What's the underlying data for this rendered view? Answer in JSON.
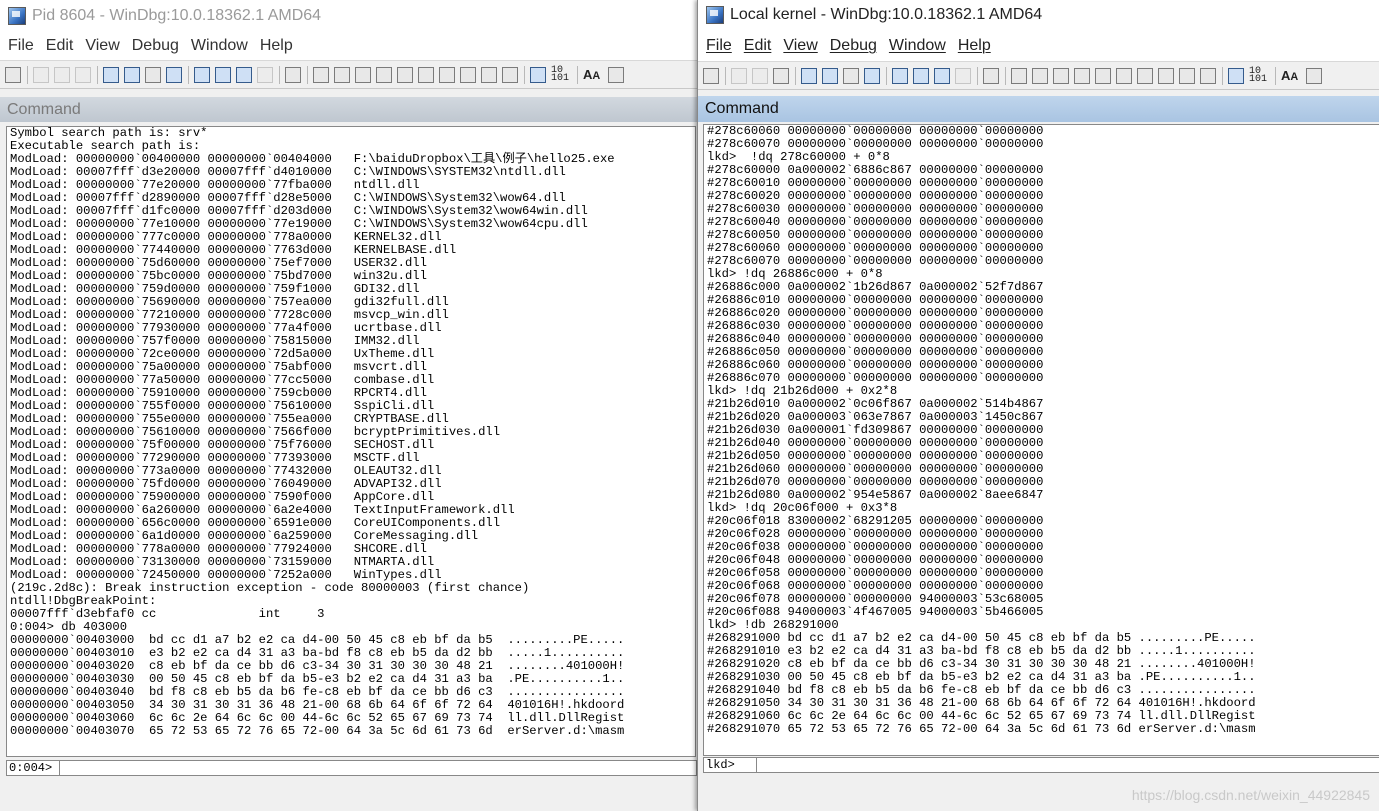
{
  "left_window": {
    "title": "Pid 8604 - WinDbg:10.0.18362.1 AMD64",
    "menu": [
      "File",
      "Edit",
      "View",
      "Debug",
      "Window",
      "Help"
    ],
    "command_header": "Command",
    "prompt": "0:004>",
    "input_value": "",
    "lines": [
      "Symbol search path is: srv*",
      "Executable search path is:",
      "ModLoad: 00000000`00400000 00000000`00404000   F:\\baiduDropbox\\工具\\例子\\hello25.exe",
      "ModLoad: 00007fff`d3e20000 00007fff`d4010000   C:\\WINDOWS\\SYSTEM32\\ntdll.dll",
      "ModLoad: 00000000`77e20000 00000000`77fba000   ntdll.dll",
      "ModLoad: 00007fff`d2890000 00007fff`d28e5000   C:\\WINDOWS\\System32\\wow64.dll",
      "ModLoad: 00007fff`d1fc0000 00007fff`d203d000   C:\\WINDOWS\\System32\\wow64win.dll",
      "ModLoad: 00000000`77e10000 00000000`77e19000   C:\\WINDOWS\\System32\\wow64cpu.dll",
      "ModLoad: 00000000`777c0000 00000000`778a0000   KERNEL32.dll",
      "ModLoad: 00000000`77440000 00000000`7763d000   KERNELBASE.dll",
      "ModLoad: 00000000`75d60000 00000000`75ef7000   USER32.dll",
      "ModLoad: 00000000`75bc0000 00000000`75bd7000   win32u.dll",
      "ModLoad: 00000000`759d0000 00000000`759f1000   GDI32.dll",
      "ModLoad: 00000000`75690000 00000000`757ea000   gdi32full.dll",
      "ModLoad: 00000000`77210000 00000000`7728c000   msvcp_win.dll",
      "ModLoad: 00000000`77930000 00000000`77a4f000   ucrtbase.dll",
      "ModLoad: 00000000`757f0000 00000000`75815000   IMM32.dll",
      "ModLoad: 00000000`72ce0000 00000000`72d5a000   UxTheme.dll",
      "ModLoad: 00000000`75a00000 00000000`75abf000   msvcrt.dll",
      "ModLoad: 00000000`77a50000 00000000`77cc5000   combase.dll",
      "ModLoad: 00000000`75910000 00000000`759cb000   RPCRT4.dll",
      "ModLoad: 00000000`755f0000 00000000`75610000   SspiCli.dll",
      "ModLoad: 00000000`755e0000 00000000`755ea000   CRYPTBASE.dll",
      "ModLoad: 00000000`75610000 00000000`7566f000   bcryptPrimitives.dll",
      "ModLoad: 00000000`75f00000 00000000`75f76000   SECHOST.dll",
      "ModLoad: 00000000`77290000 00000000`77393000   MSCTF.dll",
      "ModLoad: 00000000`773a0000 00000000`77432000   OLEAUT32.dll",
      "ModLoad: 00000000`75fd0000 00000000`76049000   ADVAPI32.dll",
      "ModLoad: 00000000`75900000 00000000`7590f000   AppCore.dll",
      "ModLoad: 00000000`6a260000 00000000`6a2e4000   TextInputFramework.dll",
      "ModLoad: 00000000`656c0000 00000000`6591e000   CoreUIComponents.dll",
      "ModLoad: 00000000`6a1d0000 00000000`6a259000   CoreMessaging.dll",
      "ModLoad: 00000000`778a0000 00000000`77924000   SHCORE.dll",
      "ModLoad: 00000000`73130000 00000000`73159000   NTMARTA.dll",
      "ModLoad: 00000000`72450000 00000000`7252a000   WinTypes.dll",
      "(219c.2d8c): Break instruction exception - code 80000003 (first chance)",
      "ntdll!DbgBreakPoint:",
      "00007fff`d3ebfaf0 cc              int     3",
      "0:004> db 403000",
      "00000000`00403000  bd cc d1 a7 b2 e2 ca d4-00 50 45 c8 eb bf da b5  .........PE.....",
      "00000000`00403010  e3 b2 e2 ca d4 31 a3 ba-bd f8 c8 eb b5 da d2 bb  .....1..........",
      "00000000`00403020  c8 eb bf da ce bb d6 c3-34 30 31 30 30 30 48 21  ........401000H!",
      "00000000`00403030  00 50 45 c8 eb bf da b5-e3 b2 e2 ca d4 31 a3 ba  .PE..........1..",
      "00000000`00403040  bd f8 c8 eb b5 da b6 fe-c8 eb bf da ce bb d6 c3  ................",
      "00000000`00403050  34 30 31 30 31 36 48 21-00 68 6b 64 6f 6f 72 64  401016H!.hkdoord",
      "00000000`00403060  6c 6c 2e 64 6c 6c 00 44-6c 6c 52 65 67 69 73 74  ll.dll.DllRegist",
      "00000000`00403070  65 72 53 65 72 76 65 72-00 64 3a 5c 6d 61 73 6d  erServer.d:\\masm"
    ]
  },
  "right_window": {
    "title": "Local kernel - WinDbg:10.0.18362.1 AMD64",
    "menu": [
      "File",
      "Edit",
      "View",
      "Debug",
      "Window",
      "Help"
    ],
    "command_header": "Command",
    "prompt": "lkd>",
    "input_value": "",
    "lines": [
      "#278c60060 00000000`00000000 00000000`00000000",
      "#278c60070 00000000`00000000 00000000`00000000",
      "lkd>  !dq 278c60000 + 0*8",
      "#278c60000 0a000002`6886c867 00000000`00000000",
      "#278c60010 00000000`00000000 00000000`00000000",
      "#278c60020 00000000`00000000 00000000`00000000",
      "#278c60030 00000000`00000000 00000000`00000000",
      "#278c60040 00000000`00000000 00000000`00000000",
      "#278c60050 00000000`00000000 00000000`00000000",
      "#278c60060 00000000`00000000 00000000`00000000",
      "#278c60070 00000000`00000000 00000000`00000000",
      "lkd> !dq 26886c000 + 0*8",
      "#26886c000 0a000002`1b26d867 0a000002`52f7d867",
      "#26886c010 00000000`00000000 00000000`00000000",
      "#26886c020 00000000`00000000 00000000`00000000",
      "#26886c030 00000000`00000000 00000000`00000000",
      "#26886c040 00000000`00000000 00000000`00000000",
      "#26886c050 00000000`00000000 00000000`00000000",
      "#26886c060 00000000`00000000 00000000`00000000",
      "#26886c070 00000000`00000000 00000000`00000000",
      "lkd> !dq 21b26d000 + 0x2*8",
      "#21b26d010 0a000002`0c06f867 0a000002`514b4867",
      "#21b26d020 0a000003`063e7867 0a000003`1450c867",
      "#21b26d030 0a000001`fd309867 00000000`00000000",
      "#21b26d040 00000000`00000000 00000000`00000000",
      "#21b26d050 00000000`00000000 00000000`00000000",
      "#21b26d060 00000000`00000000 00000000`00000000",
      "#21b26d070 00000000`00000000 00000000`00000000",
      "#21b26d080 0a000002`954e5867 0a000002`8aee6847",
      "lkd> !dq 20c06f000 + 0x3*8",
      "#20c06f018 83000002`68291205 00000000`00000000",
      "#20c06f028 00000000`00000000 00000000`00000000",
      "#20c06f038 00000000`00000000 00000000`00000000",
      "#20c06f048 00000000`00000000 00000000`00000000",
      "#20c06f058 00000000`00000000 00000000`00000000",
      "#20c06f068 00000000`00000000 00000000`00000000",
      "#20c06f078 00000000`00000000 94000003`53c68005",
      "#20c06f088 94000003`4f467005 94000003`5b466005",
      "lkd> !db 268291000",
      "#268291000 bd cc d1 a7 b2 e2 ca d4-00 50 45 c8 eb bf da b5 .........PE.....",
      "#268291010 e3 b2 e2 ca d4 31 a3 ba-bd f8 c8 eb b5 da d2 bb .....1..........",
      "#268291020 c8 eb bf da ce bb d6 c3-34 30 31 30 30 30 48 21 ........401000H!",
      "#268291030 00 50 45 c8 eb bf da b5-e3 b2 e2 ca d4 31 a3 ba .PE..........1..",
      "#268291040 bd f8 c8 eb b5 da b6 fe-c8 eb bf da ce bb d6 c3 ................",
      "#268291050 34 30 31 30 31 36 48 21-00 68 6b 64 6f 6f 72 64 401016H!.hkdoord",
      "#268291060 6c 6c 2e 64 6c 6c 00 44-6c 6c 52 65 67 69 73 74 ll.dll.DllRegist",
      "#268291070 65 72 53 65 72 76 65 72-00 64 3a 5c 6d 61 73 6d erServer.d:\\masm"
    ]
  },
  "watermark": "https://blog.csdn.net/weixin_44922845"
}
